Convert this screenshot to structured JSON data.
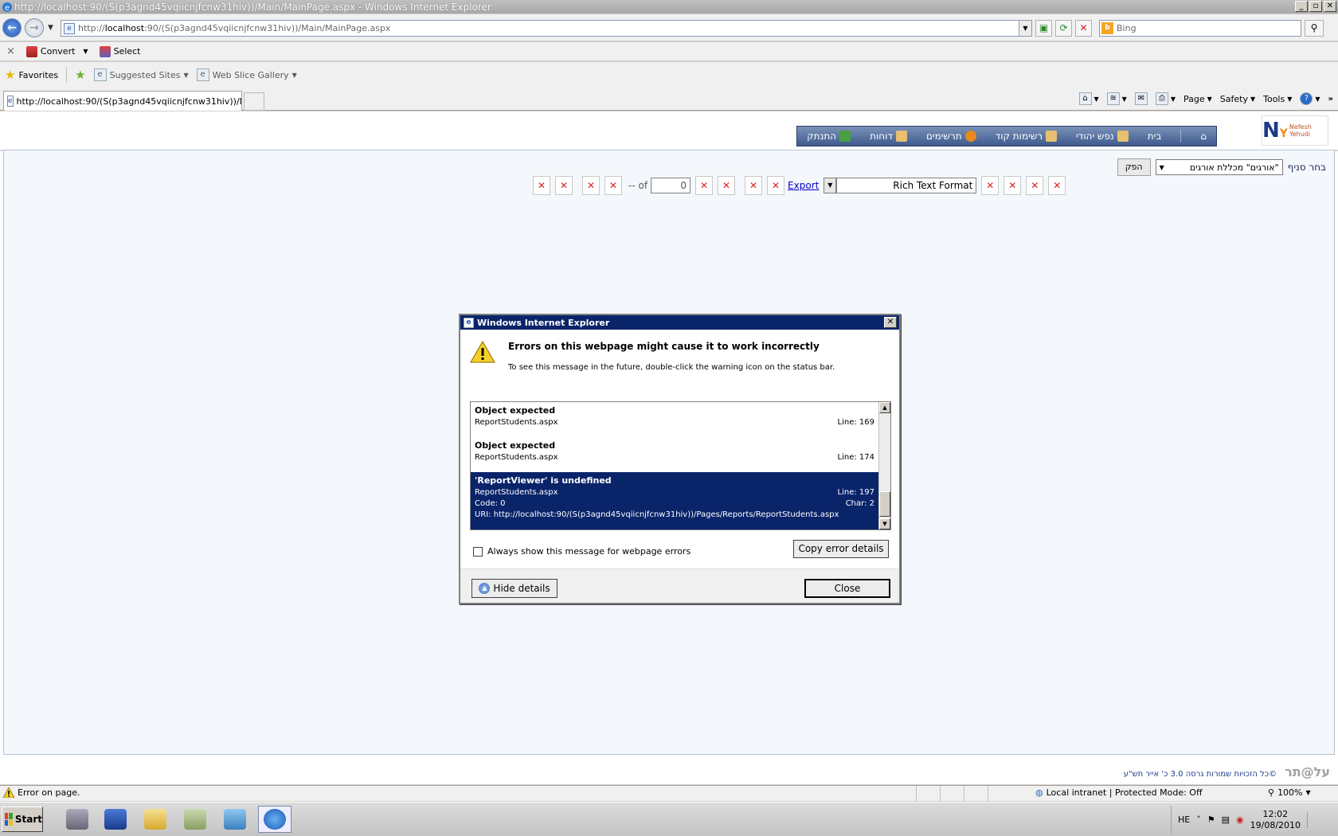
{
  "window": {
    "title": "http://localhost:90/(S(p3agnd45vqiicnjfcnw31hiv))/Main/MainPage.aspx - Windows Internet Explorer"
  },
  "address": {
    "prefix": "http://",
    "host": "localhost",
    "rest": ":90/(S(p3agnd45vqiicnjfcnw31hiv))/Main/MainPage.aspx"
  },
  "search": {
    "placeholder": "Bing"
  },
  "commandbar": {
    "convert_label": "Convert",
    "select_label": "Select"
  },
  "favorites": {
    "label": "Favorites",
    "links": [
      "Suggested Sites",
      "Web Slice Gallery"
    ]
  },
  "tab": {
    "title": "http://localhost:90/(S(p3agnd45vqiicnjfcnw31hiv))/M..."
  },
  "pagetools": {
    "page": "Page",
    "safety": "Safety",
    "tools": "Tools"
  },
  "site": {
    "logo_text": "Nefesh Yehudi",
    "menu": [
      "בית",
      "נפש יהודי",
      "רשימות קוד",
      "תרשימים",
      "דוחות",
      "התנתק"
    ],
    "branch_label": "בחר סניף",
    "branch_value": "\"אורגים\" מכללת אורגים",
    "apply_label": "הפק",
    "footer_brand": "על",
    "footer_brand_suffix": "@תר",
    "footer_copy": "©כל הזכויות שמורות גרסה 3.0 כ' אייר תש\"ע"
  },
  "reportviewer": {
    "of_label": "-- of",
    "page_value": "0",
    "export_label": "Export",
    "format_value": "Rich Text Format"
  },
  "dialog": {
    "title": "Windows Internet Explorer",
    "heading": "Errors on this webpage might cause it to work incorrectly",
    "subtext": "To see this message in the future, double-click the warning icon on the status bar.",
    "errors": [
      {
        "title": "Object expected",
        "file": "ReportStudents.aspx",
        "line": "Line: 169"
      },
      {
        "title": "Object expected",
        "file": "ReportStudents.aspx",
        "line": "Line: 174"
      },
      {
        "title": "'ReportViewer' is undefined",
        "file": "ReportStudents.aspx",
        "line": "Line: 197",
        "code": "Code: 0",
        "char": "Char: 2",
        "uri": "URI: http://localhost:90/(S(p3agnd45vqiicnjfcnw31hiv))/Pages/Reports/ReportStudents.aspx"
      }
    ],
    "checkbox_label": "Always show this message for webpage errors",
    "copy_button": "Copy error details",
    "hide_button": "Hide details",
    "close_button": "Close"
  },
  "statusbar": {
    "message": "Error on page.",
    "zone": "Local intranet | Protected Mode: Off",
    "zoom": "100%"
  },
  "taskbar": {
    "start_label": "Start",
    "lang": "HE",
    "time": "12:02",
    "date": "19/08/2010"
  }
}
